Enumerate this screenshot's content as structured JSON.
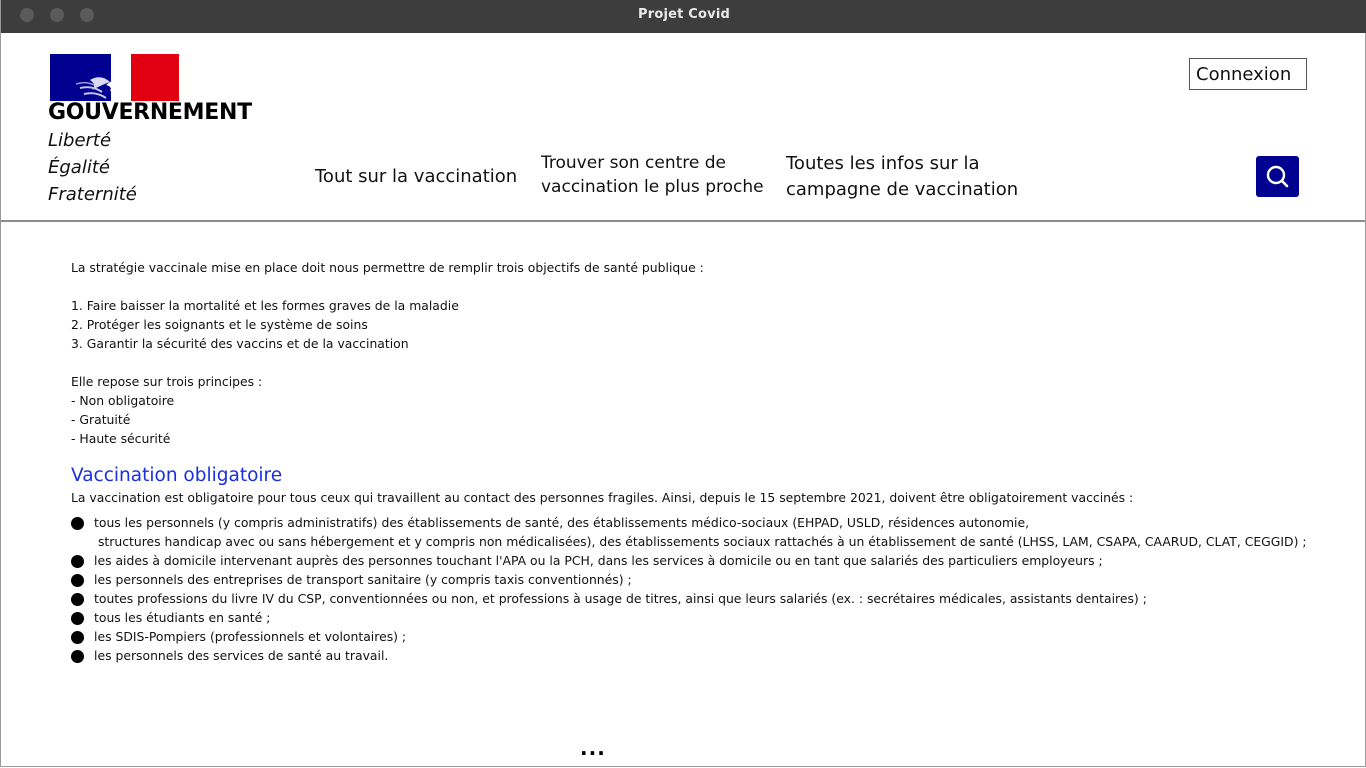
{
  "window": {
    "title": "Projet Covid"
  },
  "header": {
    "brand": "GOUVERNEMENT",
    "motto": [
      "Liberté",
      "Égalité",
      "Fraternité"
    ],
    "login_label": "Connexion",
    "nav": [
      {
        "label": "Tout sur la vaccination"
      },
      {
        "line1": "Trouver son centre de",
        "line2": "vaccination le plus proche"
      },
      {
        "line1": "Toutes les infos sur la",
        "line2": "campagne de vaccination"
      }
    ],
    "search_icon": "search-icon",
    "colors": {
      "accent": "#000091",
      "flag_red": "#e1000f"
    }
  },
  "content": {
    "intro": "La stratégie vaccinale mise en place doit nous permettre de remplir trois objectifs de santé publique :",
    "objectives": [
      "1. Faire baisser la mortalité et les formes graves de la maladie",
      "2. Protéger les soignants et le système de soins",
      "3. Garantir la sécurité des vaccins et de la vaccination"
    ],
    "principles_intro": "Elle repose sur trois principes :",
    "principles": [
      "- Non obligatoire",
      "- Gratuité",
      "- Haute sécurité"
    ],
    "section_title": "Vaccination obligatoire",
    "section_intro": "La vaccination est obligatoire pour tous ceux qui travaillent au contact des personnes fragiles. Ainsi, depuis le 15 septembre 2021, doivent être obligatoirement vaccinés :",
    "bullet_first_line1": "tous les personnels (y compris administratifs) des établissements de santé, des établissements médico-sociaux (EHPAD, USLD, résidences autonomie,",
    "bullet_first_line2": " structures handicap avec ou sans hébergement et y compris non médicalisées), des établissements sociaux rattachés à un établissement de santé (LHSS, LAM, CSAPA, CAARUD, CLAT, CEGGID) ;",
    "bullets": [
      "les aides à domicile intervenant auprès des personnes touchant l'APA ou la PCH, dans les services à domicile ou en tant que salariés des particuliers employeurs ;",
      "les personnels des entreprises de transport sanitaire (y compris taxis conventionnés) ;",
      "toutes professions du livre IV du CSP, conventionnées ou non, et professions à usage de titres, ainsi que leurs salariés (ex. : secrétaires médicales, assistants dentaires) ;",
      "tous les étudiants en santé ;",
      "les SDIS-Pompiers (professionnels et volontaires) ;",
      "les personnels des services de santé au travail."
    ],
    "more": "..."
  }
}
